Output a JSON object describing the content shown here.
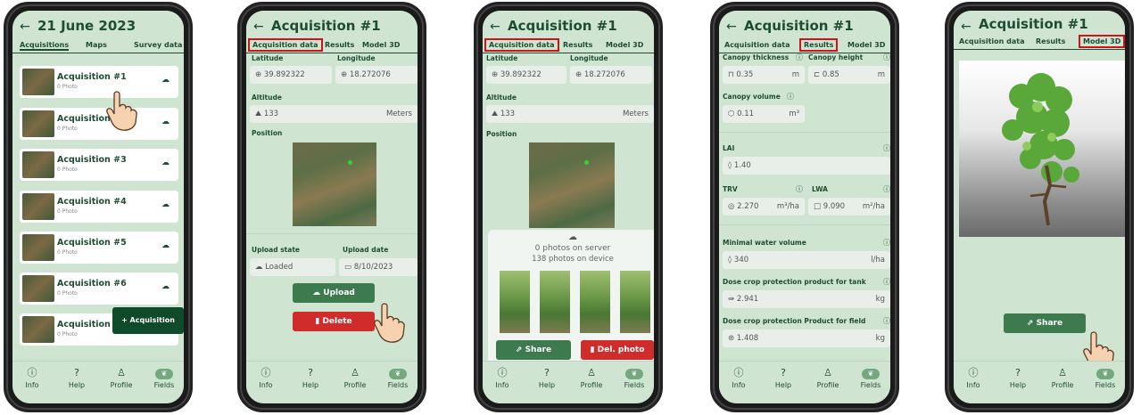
{
  "nav": {
    "items": [
      {
        "label": "Info",
        "icon": "info-icon"
      },
      {
        "label": "Help",
        "icon": "help-icon"
      },
      {
        "label": "Profile",
        "icon": "profile-icon"
      },
      {
        "label": "Fields",
        "icon": "leaf-icon"
      }
    ]
  },
  "screen1": {
    "title": "21 June 2023",
    "tabs": [
      "Acquisitions",
      "Maps",
      "Survey data"
    ],
    "items": [
      {
        "name": "Acquisition #1",
        "sub": "0 Photo"
      },
      {
        "name": "Acquisition #2",
        "sub": "0 Photo"
      },
      {
        "name": "Acquisition #3",
        "sub": "0 Photo"
      },
      {
        "name": "Acquisition #4",
        "sub": "0 Photo"
      },
      {
        "name": "Acquisition #5",
        "sub": "0 Photo"
      },
      {
        "name": "Acquisition #6",
        "sub": "0 Photo"
      },
      {
        "name": "Acquisition",
        "sub": "0 Photo"
      }
    ],
    "fab": "+ Acquisition"
  },
  "screen2": {
    "title": "Acquisition #1",
    "tabs": [
      "Acquisition data",
      "Results",
      "Model 3D"
    ],
    "latitude_label": "Latitude",
    "longitude_label": "Longitude",
    "latitude": "39.892322",
    "longitude": "18.272076",
    "altitude_label": "Altitude",
    "altitude": "133",
    "altitude_unit": "Meters",
    "position_label": "Position",
    "upload_state_label": "Upload state",
    "upload_date_label": "Upload date",
    "upload_state": "Loaded",
    "upload_date": "8/10/2023",
    "upload_button": "Upload",
    "delete_button": "Delete"
  },
  "screen3": {
    "title": "Acquisition #1",
    "tabs": [
      "Acquisition data",
      "Results",
      "Model 3D"
    ],
    "latitude_label": "Latitude",
    "longitude_label": "Longitude",
    "latitude": "39.892322",
    "longitude": "18.272076",
    "altitude_label": "Altitude",
    "altitude": "133",
    "altitude_unit": "Meters",
    "position_label": "Position",
    "server_text": "0 photos on server",
    "device_text": "138 photos on device",
    "share_button": "Share",
    "del_button": "Del. photo"
  },
  "screen4": {
    "title": "Acquisition #1",
    "tabs": [
      "Acquisition data",
      "Results",
      "Model 3D"
    ],
    "canopy_thickness_label": "Canopy thickness",
    "canopy_height_label": "Canopy height",
    "canopy_thickness": "0.35",
    "canopy_thickness_unit": "m",
    "canopy_height": "0.85",
    "canopy_height_unit": "m",
    "canopy_volume_label": "Canopy volume",
    "canopy_volume": "0.11",
    "canopy_volume_unit": "m³",
    "lai_label": "LAI",
    "lai": "1.40",
    "trv_label": "TRV",
    "lwa_label": "LWA",
    "trv": "2.270",
    "trv_unit": "m³/ha",
    "lwa": "9.090",
    "lwa_unit": "m²/ha",
    "water_label": "Minimal water volume",
    "water": "340",
    "water_unit": "l/ha",
    "tank_label": "Dose crop protection product for tank",
    "tank": "2.941",
    "tank_unit": "kg",
    "field_label": "Dose crop protection Product for field",
    "field": "1.408",
    "field_unit": "kg"
  },
  "screen5": {
    "title": "Acquisition #1",
    "tabs": [
      "Acquisition data",
      "Results",
      "Model 3D"
    ],
    "share_button": "Share"
  },
  "colors": {
    "bg": "#cfe5d2",
    "primary": "#1f4d33",
    "highlight": "#d1121a",
    "danger": "#d12c2c",
    "button": "#3d7a4e"
  }
}
